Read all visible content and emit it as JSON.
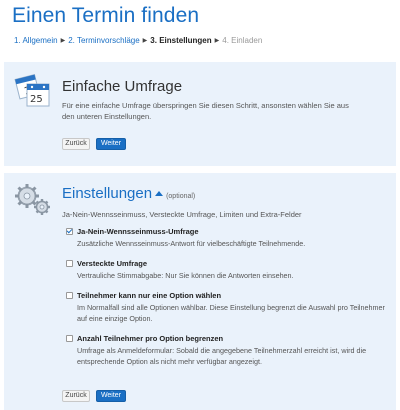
{
  "page": {
    "title": "Einen Termin finden"
  },
  "steps": [
    {
      "label": "1. Allgemein",
      "state": "link"
    },
    {
      "label": "2. Terminvorschläge",
      "state": "link"
    },
    {
      "label": "3. Einstellungen",
      "state": "current"
    },
    {
      "label": "4. Einladen",
      "state": "future"
    }
  ],
  "simple_poll": {
    "title": "Einfache Umfrage",
    "description": "Für eine einfache Umfrage überspringen Sie diesen Schritt, ansonsten wählen Sie aus den unteren Einstellungen.",
    "calendar_icon_text": "1 25",
    "back_label": "Zurück",
    "next_label": "Weiter"
  },
  "settings": {
    "title": "Einstellungen",
    "optional_tag": "(optional)",
    "summary": "Ja-Nein-Wennsseinmuss, Versteckte Umfrage, Limiten und Extra-Felder",
    "options": [
      {
        "title": "Ja-Nein-Wennsseinmuss-Umfrage",
        "description": "Zusätzliche Wennsseinmuss-Antwort für vielbeschäftigte Teilnehmende.",
        "checked": true
      },
      {
        "title": "Versteckte Umfrage",
        "description": "Vertrauliche Stimmabgabe: Nur Sie können die Antworten einsehen.",
        "checked": false
      },
      {
        "title": "Teilnehmer kann nur eine Option wählen",
        "description": "Im Normalfall sind alle Optionen wählbar. Diese Einstellung begrenzt die Auswahl pro Teilnehmer auf eine einzige Option.",
        "checked": false
      },
      {
        "title": "Anzahl Teilnehmer pro Option begrenzen",
        "description": "Umfrage als Anmeldeformular: Sobald die angegebene Teilnehmerzahl erreicht ist, wird die entsprechende Option als nicht mehr verfügbar angezeigt.",
        "checked": false
      }
    ],
    "back_label": "Zurück",
    "next_label": "Weiter"
  },
  "colors": {
    "accent": "#1a6fc4",
    "panel_bg": "#eaf2fb"
  },
  "icons": {
    "simple_poll": "calendar-icon",
    "settings": "gears-icon",
    "toggle": "chevron-up-icon"
  }
}
